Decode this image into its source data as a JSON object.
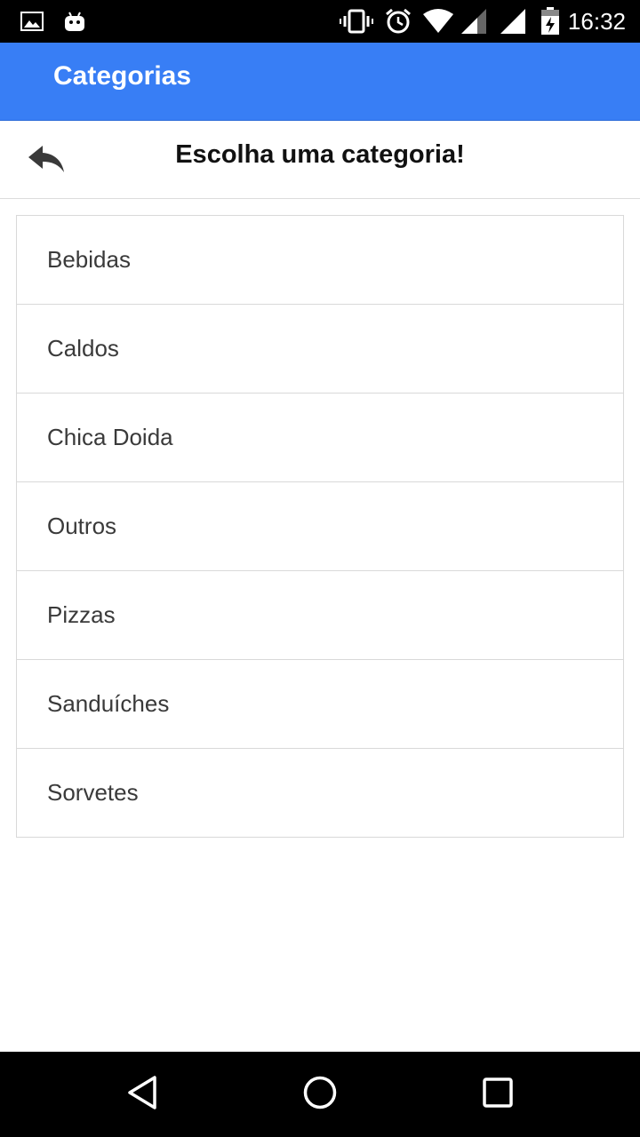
{
  "status_bar": {
    "time": "16:32",
    "icons": [
      "image-icon",
      "android-icon",
      "vibrate-icon",
      "alarm-icon",
      "wifi-icon",
      "signal-icon",
      "signal-icon",
      "battery-charging-icon"
    ]
  },
  "app_bar": {
    "title": "Categorias",
    "color": "#387ef5"
  },
  "header": {
    "title": "Escolha uma categoria!",
    "back_icon": "reply-icon"
  },
  "categories": [
    {
      "label": "Bebidas"
    },
    {
      "label": "Caldos"
    },
    {
      "label": "Chica Doida"
    },
    {
      "label": "Outros"
    },
    {
      "label": "Pizzas"
    },
    {
      "label": "Sanduíches"
    },
    {
      "label": "Sorvetes"
    }
  ],
  "nav_bar": {
    "buttons": [
      "back-triangle-icon",
      "home-circle-icon",
      "recents-square-icon"
    ]
  }
}
